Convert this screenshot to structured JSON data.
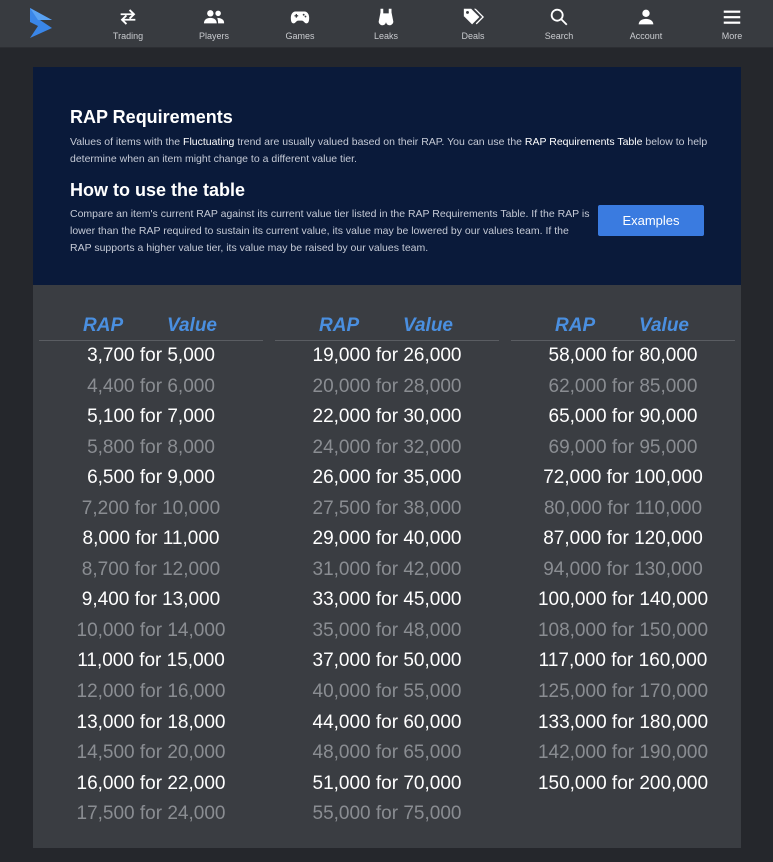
{
  "nav": {
    "items": [
      {
        "label": "Trading",
        "icon": "trading-arrows-icon"
      },
      {
        "label": "Players",
        "icon": "players-icon"
      },
      {
        "label": "Games",
        "icon": "gamepad-icon"
      },
      {
        "label": "Leaks",
        "icon": "binoculars-icon"
      },
      {
        "label": "Deals",
        "icon": "tags-icon"
      },
      {
        "label": "Search",
        "icon": "search-icon"
      },
      {
        "label": "Account",
        "icon": "account-icon"
      },
      {
        "label": "More",
        "icon": "hamburger-menu-icon"
      }
    ]
  },
  "info": {
    "title": "RAP Requirements",
    "p1_a": "Values of items with the ",
    "p1_b": "Fluctuating",
    "p1_c": " trend are usually valued based on their RAP. You can use the ",
    "p1_d": "RAP Requirements Table",
    "p1_e": " below to help determine when an item might change to a different value tier.",
    "how_title": "How to use the table",
    "p2": "Compare an item's current RAP against its current value tier listed in the RAP Requirements Table. If the RAP is lower than the RAP required to sustain its current value, its value may be lowered by our values team. If the RAP supports a higher value tier, its value may be raised by our values team.",
    "examples_label": "Examples"
  },
  "table": {
    "rap_header": "RAP",
    "value_header": "Value",
    "columns": [
      [
        "3,700 for 5,000",
        "4,400 for 6,000",
        "5,100 for 7,000",
        "5,800 for 8,000",
        "6,500 for 9,000",
        "7,200 for 10,000",
        "8,000 for 11,000",
        "8,700 for 12,000",
        "9,400 for 13,000",
        "10,000 for 14,000",
        "11,000 for 15,000",
        "12,000 for 16,000",
        "13,000 for 18,000",
        "14,500 for 20,000",
        "16,000 for 22,000",
        "17,500 for 24,000"
      ],
      [
        "19,000 for 26,000",
        "20,000 for 28,000",
        "22,000 for 30,000",
        "24,000 for 32,000",
        "26,000 for 35,000",
        "27,500 for 38,000",
        "29,000 for 40,000",
        "31,000 for 42,000",
        "33,000 for 45,000",
        "35,000 for 48,000",
        "37,000 for 50,000",
        "40,000 for 55,000",
        "44,000 for 60,000",
        "48,000 for 65,000",
        "51,000 for 70,000",
        "55,000 for 75,000"
      ],
      [
        "58,000 for 80,000",
        "62,000 for 85,000",
        "65,000 for 90,000",
        "69,000 for 95,000",
        "72,000 for 100,000",
        "80,000 for 110,000",
        "87,000 for 120,000",
        "94,000 for 130,000",
        "100,000 for 140,000",
        "108,000 for 150,000",
        "117,000 for 160,000",
        "125,000 for 170,000",
        "133,000 for 180,000",
        "142,000 for 190,000",
        "150,000 for 200,000"
      ]
    ]
  }
}
